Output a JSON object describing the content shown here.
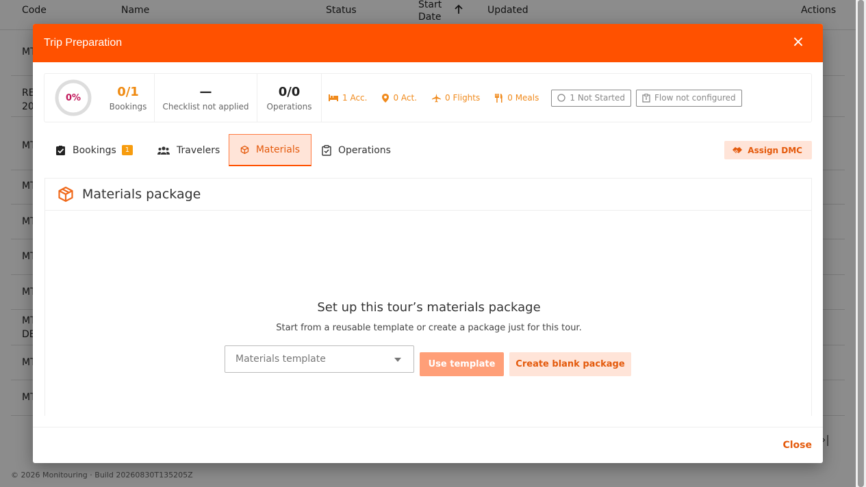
{
  "background": {
    "headers": {
      "code": "Code",
      "name": "Name",
      "status": "Status",
      "start_date": "Start Date",
      "updated": "Updated",
      "actions": "Actions"
    },
    "rows": [
      "MT",
      "RE 20",
      "MT",
      "MT",
      "MT",
      "MT",
      "MT",
      "MT DE",
      "MT",
      "MT"
    ],
    "footer": "© 2026 Monitouring · Build 20260830T135205Z",
    "pager_last": "›|"
  },
  "modal": {
    "title": "Trip Preparation",
    "close_icon": "×",
    "progress": {
      "percent_label": "0%",
      "value": 0
    },
    "stats": {
      "bookings": {
        "value": "0/1",
        "label": "Bookings"
      },
      "checklist": {
        "value": "—",
        "label": "Checklist not applied"
      },
      "operations": {
        "value": "0/0",
        "label": "Operations"
      }
    },
    "pills": {
      "acc": "1 Acc.",
      "act": "0 Act.",
      "flights": "0 Flights",
      "meals": "0 Meals"
    },
    "status_badges": {
      "not_started": "1 Not Started",
      "flow": "Flow not configured"
    },
    "tabs": {
      "bookings": {
        "label": "Bookings",
        "badge": "1"
      },
      "travelers": {
        "label": "Travelers"
      },
      "materials": {
        "label": "Materials"
      },
      "operations": {
        "label": "Operations"
      }
    },
    "assign_dmc": "Assign DMC",
    "panel": {
      "title": "Materials package",
      "empty_title": "Set up this tour’s materials package",
      "empty_text": "Start from a reusable template or create a package just for this tour.",
      "select_placeholder": "Materials template",
      "use_template": "Use template",
      "create_blank": "Create blank package"
    },
    "footer_close": "Close"
  },
  "colors": {
    "brand": "#ff5100",
    "accent_light": "#ffe4d8",
    "stat_orange": "#ef8a11",
    "progress_text": "#c2185b"
  }
}
